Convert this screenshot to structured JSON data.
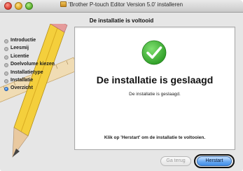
{
  "window": {
    "title": "'Brother P-touch Editor Version 5.0' installeren",
    "subtitle": "De installatie is voltooid"
  },
  "sidebar": {
    "steps": [
      {
        "label": "Introductie",
        "state": "done"
      },
      {
        "label": "Leesmij",
        "state": "done"
      },
      {
        "label": "Licentie",
        "state": "done"
      },
      {
        "label": "Doelvolume kiezen",
        "state": "done"
      },
      {
        "label": "Installatietype",
        "state": "done"
      },
      {
        "label": "Installatie",
        "state": "done"
      },
      {
        "label": "Overzicht",
        "state": "active"
      }
    ]
  },
  "main": {
    "icon": "check-circle-icon",
    "headline": "De installatie is geslaagd",
    "message": "De installatie is geslaagd.",
    "instruction": "Klik op 'Herstart' om de installatie te voltooien."
  },
  "buttons": {
    "back_label": "Ga terug",
    "back_enabled": false,
    "continue_label": "Herstart"
  },
  "colors": {
    "success_green": "#3fb536",
    "default_button_blue": "#6aa9f0",
    "active_step_blue": "#2f7ce0"
  }
}
